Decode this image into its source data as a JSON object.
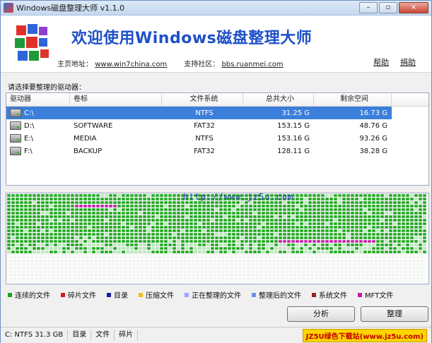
{
  "window": {
    "title": "Windows磁盘整理大师 v1.1.0",
    "min": "–",
    "max": "▫",
    "close": "×"
  },
  "header": {
    "title": "欢迎使用Windows磁盘整理大师",
    "home_label": "主页地址：",
    "home_url": "www.win7china.com",
    "forum_label": "支持社区：",
    "forum_url": "bbs.ruanmei.com",
    "help": "帮助",
    "donate": "捐助"
  },
  "drives": {
    "prompt": "请选择要整理的驱动器：",
    "columns": [
      "驱动器",
      "卷标",
      "文件系统",
      "总共大小",
      "剩余空间"
    ],
    "rows": [
      {
        "drive": "C:\\",
        "label": "",
        "fs": "NTFS",
        "total": "31.25 G",
        "free": "16.73 G"
      },
      {
        "drive": "D:\\",
        "label": "SOFTWARE",
        "fs": "FAT32",
        "total": "153.15 G",
        "free": "48.76 G"
      },
      {
        "drive": "E:\\",
        "label": "MEDIA",
        "fs": "NTFS",
        "total": "153.16 G",
        "free": "93.26 G"
      },
      {
        "drive": "F:\\",
        "label": "BACKUP",
        "fs": "FAT32",
        "total": "128.11 G",
        "free": "38.28 G"
      }
    ]
  },
  "map": {
    "watermark": "http://www.jz5u.com"
  },
  "legend": [
    {
      "label": "连续的文件",
      "color": "#1aa81a"
    },
    {
      "label": "碎片文件",
      "color": "#e01515"
    },
    {
      "label": "目录",
      "color": "#1c1ca0"
    },
    {
      "label": "压缩文件",
      "color": "#e8c21a"
    },
    {
      "label": "正在整理的文件",
      "color": "#9ea6ff"
    },
    {
      "label": "整理后的文件",
      "color": "#6e93e8"
    },
    {
      "label": "系统文件",
      "color": "#8c2a1a"
    },
    {
      "label": "MFT文件",
      "color": "#c41aa8"
    }
  ],
  "buttons": {
    "analyze": "分析",
    "defrag": "整理"
  },
  "status": {
    "drive_info": "C: NTFS 31.3 GB",
    "col1": "目录",
    "col2": "文件",
    "col3": "碎片",
    "promo": "JZ5U绿色下载站(www.jz5u.com)"
  }
}
